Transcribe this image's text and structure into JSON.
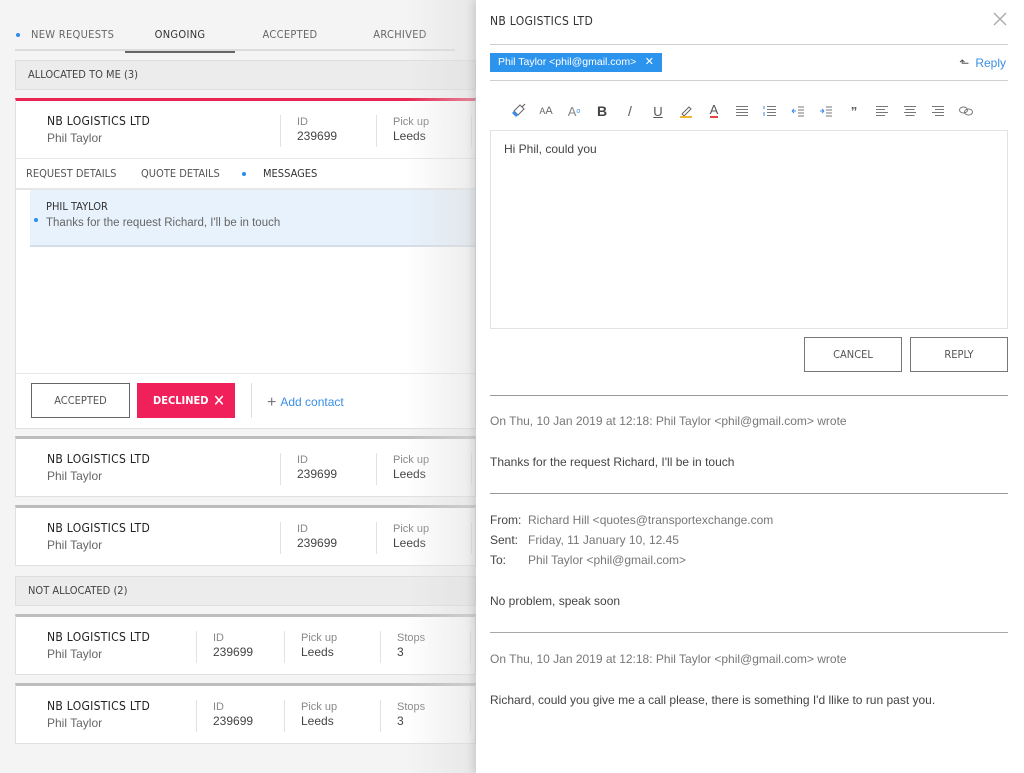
{
  "tabs": [
    {
      "label": "NEW REQUESTS",
      "has_dot": true
    },
    {
      "label": "ONGOING",
      "active": true
    },
    {
      "label": "ACCEPTED"
    },
    {
      "label": "ARCHIVED"
    }
  ],
  "sections": {
    "allocated": {
      "title": "ALLOCATED TO ME (3)"
    },
    "not_allocated": {
      "title": "NOT ALLOCATED (2)"
    }
  },
  "field_labels": {
    "id": "ID",
    "pickup": "Pick up",
    "stops": "Stops"
  },
  "cards": [
    {
      "company": "NB LOGISTICS LTD",
      "contact": "Phil Taylor",
      "id": "239699",
      "pickup": "Leeds"
    },
    {
      "company": "NB LOGISTICS LTD",
      "contact": "Phil Taylor",
      "id": "239699",
      "pickup": "Leeds"
    },
    {
      "company": "NB LOGISTICS LTD",
      "contact": "Phil Taylor",
      "id": "239699",
      "pickup": "Leeds"
    },
    {
      "company": "NB LOGISTICS LTD",
      "contact": "Phil Taylor",
      "id": "239699",
      "pickup": "Leeds",
      "stops": "3"
    },
    {
      "company": "NB LOGISTICS LTD",
      "contact": "Phil Taylor",
      "id": "239699",
      "pickup": "Leeds",
      "stops": "3"
    }
  ],
  "detail_tabs": [
    {
      "label": "REQUEST DETAILS"
    },
    {
      "label": "QUOTE DETAILS"
    },
    {
      "label": "MESSAGES",
      "active": true,
      "has_dot": true
    }
  ],
  "message_preview": {
    "sender": "PHIL TAYLOR",
    "text": "Thanks for the request Richard, I'll be in touch"
  },
  "card_actions": {
    "accepted": "ACCEPTED",
    "declined": "DECLINED",
    "add_contact": "Add contact"
  },
  "drawer": {
    "title": "NB LOGISTICS LTD",
    "recipient": "Phil Taylor <phil@gmail.com>",
    "reply_link": "Reply",
    "toolbar": [
      "format-painter",
      "font-size",
      "superscript",
      "bold",
      "italic",
      "underline",
      "highlight",
      "font-color",
      "bulleted-list",
      "numbered-list",
      "outdent",
      "indent",
      "blockquote",
      "align-left",
      "align-center",
      "align-right",
      "link"
    ],
    "editor_text": "Hi Phil, could you",
    "cancel_label": "CANCEL",
    "reply_label": "REPLY",
    "colors": {
      "accent": "#2d94ee",
      "declined": "#f0215a",
      "active_card": "#e8244f"
    },
    "thread": [
      {
        "header": "On Thu, 10 Jan 2019 at 12:18: Phil Taylor <phil@gmail.com> wrote",
        "body": "Thanks for the request Richard, I'll be in touch"
      },
      {
        "from_label": "From:",
        "from": "Richard Hill <quotes@transportexchange.com",
        "sent_label": "Sent:",
        "sent": "Friday, 11 January 10, 12.45",
        "to_label": "To:",
        "to": "Phil Taylor <phil@gmail.com>",
        "body": "No problem, speak soon"
      },
      {
        "header": "On Thu, 10 Jan 2019 at 12:18: Phil Taylor <phil@gmail.com> wrote",
        "body": "Richard, could you give me a call please, there is something I'd llike to run past you."
      }
    ]
  }
}
